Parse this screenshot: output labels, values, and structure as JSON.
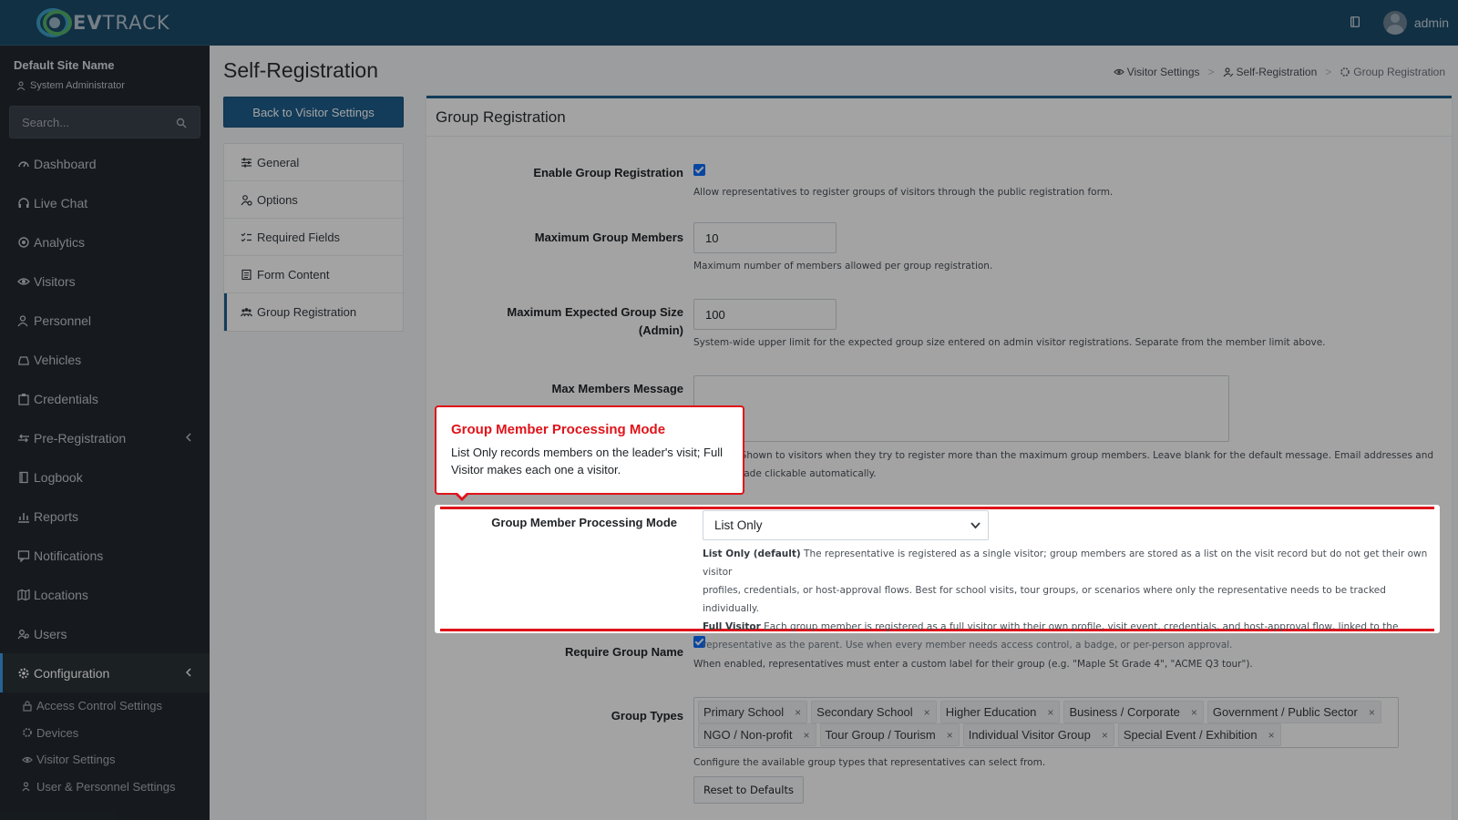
{
  "brand": {
    "name_bold": "EV",
    "name_rest": "TRACK"
  },
  "topbar": {
    "user": "admin"
  },
  "sidebar": {
    "site_name": "Default Site Name",
    "role": "System Administrator",
    "search_placeholder": "Search...",
    "items": [
      {
        "label": "Dashboard",
        "icon": "dashboard-icon"
      },
      {
        "label": "Live Chat",
        "icon": "headset-icon"
      },
      {
        "label": "Analytics",
        "icon": "analytics-icon"
      },
      {
        "label": "Visitors",
        "icon": "eye-icon"
      },
      {
        "label": "Personnel",
        "icon": "personnel-icon"
      },
      {
        "label": "Vehicles",
        "icon": "car-icon"
      },
      {
        "label": "Credentials",
        "icon": "badge-icon"
      },
      {
        "label": "Pre-Registration",
        "icon": "arrows-icon"
      },
      {
        "label": "Logbook",
        "icon": "book-icon"
      },
      {
        "label": "Reports",
        "icon": "chart-icon"
      },
      {
        "label": "Notifications",
        "icon": "bell-icon"
      },
      {
        "label": "Locations",
        "icon": "map-icon"
      },
      {
        "label": "Users",
        "icon": "users-icon"
      },
      {
        "label": "Configuration",
        "icon": "gear-icon"
      }
    ],
    "sub_items": [
      {
        "label": "Access Control Settings",
        "icon": "lock-icon"
      },
      {
        "label": "Devices",
        "icon": "device-icon"
      },
      {
        "label": "Visitor Settings",
        "icon": "eye-icon"
      },
      {
        "label": "User & Personnel Settings",
        "icon": "users-icon"
      }
    ]
  },
  "page": {
    "title": "Self-Registration",
    "back_button": "Back to Visitor Settings",
    "breadcrumb": [
      "Visitor Settings",
      "Self-Registration",
      "Group Registration"
    ],
    "subnav": [
      "General",
      "Options",
      "Required Fields",
      "Form Content",
      "Group Registration"
    ]
  },
  "card": {
    "title": "Group Registration",
    "enable": {
      "label": "Enable Group Registration",
      "help": "Allow representatives to register groups of visitors through the public registration form."
    },
    "max_members": {
      "label": "Maximum Group Members",
      "value": "10",
      "help": "Maximum number of members allowed per group registration."
    },
    "max_expected": {
      "label_1": "Maximum Expected Group Size",
      "label_2": "(Admin)",
      "value": "100",
      "help": "System-wide upper limit for the expected group size entered on admin visitor registrations. Separate from the member limit above."
    },
    "max_message": {
      "label": "Max Members Message",
      "help_1": ". Shown to visitors when they try to register more than the maximum group members. Leave blank for the default message. Email addresses and",
      "help_2": "made clickable automatically."
    },
    "processing_mode": {
      "label": "Group Member Processing Mode",
      "value": "List Only",
      "list_only_title": "List Only (default)",
      "list_only_text": " The representative is registered as a single visitor; group members are stored as a list on the visit record but do not get their own visitor",
      "list_only_text_2": "profiles, credentials, or host-approval flows. Best for school visits, tour groups, or scenarios where only the representative needs to be tracked individually.",
      "full_title": "Full Visitor",
      "full_text": " Each group member is registered as a full visitor with their own profile, visit event, credentials, and host-approval flow, linked to the",
      "full_text_2": "representative as the parent. Use when every member needs access control, a badge, or per-person approval."
    },
    "require_name": {
      "label": "Require Group Name",
      "help": "When enabled, representatives must enter a custom label for their group (e.g. \"Maple St Grade 4\", \"ACME Q3 tour\")."
    },
    "group_types": {
      "label": "Group Types",
      "tags": [
        "Primary School",
        "Secondary School",
        "Higher Education",
        "Business / Corporate",
        "Government / Public Sector",
        "NGO / Non-profit",
        "Tour Group / Tourism",
        "Individual Visitor Group",
        "Special Event / Exhibition"
      ],
      "help": "Configure the available group types that representatives can select from.",
      "reset": "Reset to Defaults"
    }
  },
  "tooltip": {
    "title": "Group Member Processing Mode",
    "body": "List Only records members on the leader's visit; Full Visitor makes each one a visitor."
  },
  "colors": {
    "accent": "#1f5f8d",
    "highlight": "#e0131a",
    "sidebar": "#232a31",
    "topbar": "#1c4b6b"
  }
}
